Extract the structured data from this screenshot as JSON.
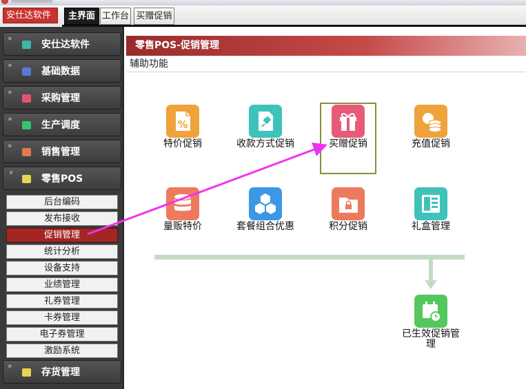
{
  "app": {
    "brand_label": "安仕达软件"
  },
  "tabs": [
    {
      "label": "主界面"
    },
    {
      "label": "工作台"
    },
    {
      "label": "买赠促销"
    }
  ],
  "sidebar": {
    "headers": [
      {
        "label": "安仕达软件",
        "color": "#3fb7a7"
      },
      {
        "label": "基础数据",
        "color": "#5a78d8"
      },
      {
        "label": "采购管理",
        "color": "#e4546a"
      },
      {
        "label": "生产调度",
        "color": "#36c46b"
      },
      {
        "label": "销售管理",
        "color": "#e27a4d"
      },
      {
        "label": "零售POS",
        "color": "#e8d352"
      },
      {
        "label": "存货管理",
        "color": "#e8d352"
      }
    ],
    "pos_items": [
      {
        "label": "后台编码"
      },
      {
        "label": "发布接收"
      },
      {
        "label": "促销管理"
      },
      {
        "label": "统计分析"
      },
      {
        "label": "设备支持"
      },
      {
        "label": "业绩管理"
      },
      {
        "label": "礼券管理"
      },
      {
        "label": "卡券管理"
      },
      {
        "label": "电子券管理"
      },
      {
        "label": "激励系统"
      }
    ]
  },
  "content": {
    "title": "零售POS-促销管理",
    "subtitle": "辅助功能",
    "tiles": [
      {
        "label": "特价促销",
        "icon": "percent-doc-icon",
        "color": "#f0a23c"
      },
      {
        "label": "收款方式促销",
        "icon": "pin-doc-icon",
        "color": "#3fc2ba"
      },
      {
        "label": "买赠促销",
        "icon": "gift-icon",
        "color": "#e85a78"
      },
      {
        "label": "充值促销",
        "icon": "coin-stack-icon",
        "color": "#f0a23c"
      },
      {
        "label": "量贩特价",
        "icon": "database-icon",
        "color": "#ee7a5e"
      },
      {
        "label": "套餐组合优惠",
        "icon": "cubes-icon",
        "color": "#3c98e6"
      },
      {
        "label": "积分促销",
        "icon": "lock-folder-icon",
        "color": "#ee7a5e"
      },
      {
        "label": "礼盒管理",
        "icon": "panel-icon",
        "color": "#3fc2ba"
      },
      {
        "label": "已生效促销管理",
        "icon": "calendar-clock-icon",
        "color": "#54c85e"
      }
    ]
  }
}
